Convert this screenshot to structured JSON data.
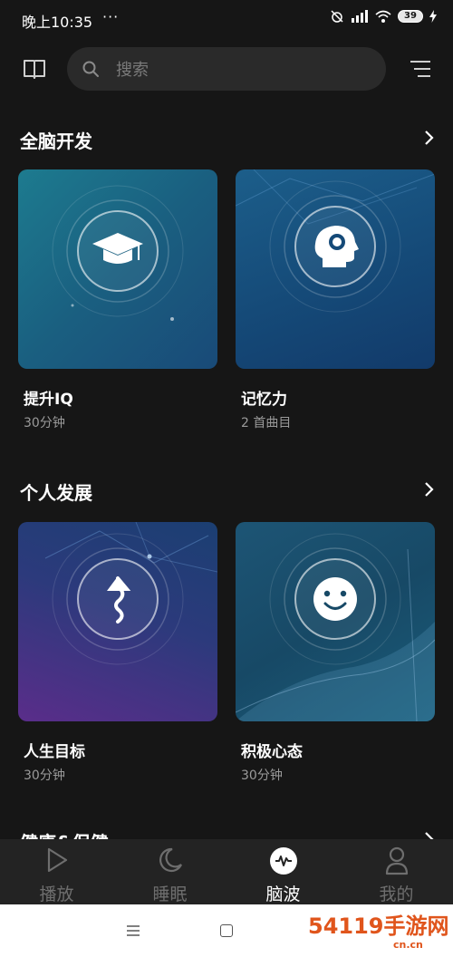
{
  "status_bar": {
    "time": "晚上10:35",
    "dots": "···",
    "battery": "39"
  },
  "header": {
    "search_placeholder": "搜索"
  },
  "sections": [
    {
      "title": "全脑开发",
      "cards": [
        {
          "title": "提升IQ",
          "subtitle": "30分钟",
          "icon": "graduation-cap-icon"
        },
        {
          "title": "记忆力",
          "subtitle": "2 首曲目",
          "icon": "head-brain-icon"
        }
      ]
    },
    {
      "title": "个人发展",
      "cards": [
        {
          "title": "人生目标",
          "subtitle": "30分钟",
          "icon": "wavy-arrow-up-icon"
        },
        {
          "title": "积极心态",
          "subtitle": "30分钟",
          "icon": "smiley-icon"
        }
      ]
    },
    {
      "title": "健康&保健"
    }
  ],
  "bottom_nav": [
    {
      "label": "播放",
      "icon": "play-icon",
      "active": false
    },
    {
      "label": "睡眠",
      "icon": "moon-icon",
      "active": false
    },
    {
      "label": "脑波",
      "icon": "brainwave-icon",
      "active": true
    },
    {
      "label": "我的",
      "icon": "person-icon",
      "active": false
    }
  ],
  "watermark": {
    "text": "54119手游网",
    "sub": "cn.cn"
  },
  "colors": {
    "background": "#161616",
    "card_subtitle": "#9a9a9a",
    "nav_inactive": "#6e6e6e",
    "watermark": "#e0551c"
  }
}
